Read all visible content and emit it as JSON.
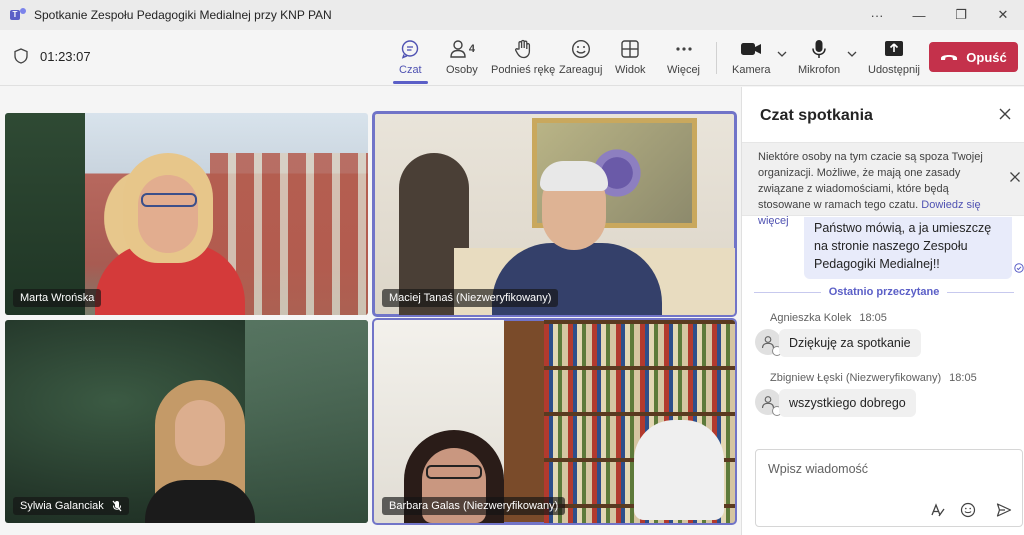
{
  "window": {
    "title": "Spotkanie Zespołu Pedagogiki Medialnej przy KNP PAN",
    "more_glyph": "···",
    "minimize_glyph": "—",
    "restore_glyph": "❐",
    "close_glyph": "✕"
  },
  "toolbar": {
    "timer": "01:23:07",
    "chat_label": "Czat",
    "people_label": "Osoby",
    "people_count": "4",
    "raise_hand_label": "Podnieś rękę",
    "react_label": "Zareaguj",
    "view_label": "Widok",
    "more_label": "Więcej",
    "camera_label": "Kamera",
    "mic_label": "Mikrofon",
    "share_label": "Udostępnij",
    "leave_label": "Opuść"
  },
  "participants": [
    {
      "name": "Marta Wrońska"
    },
    {
      "name": "Maciej Tanaś (Niezweryfikowany)"
    },
    {
      "name": "Sylwia Galanciak",
      "muted": true
    },
    {
      "name": "Barbara Galas (Niezweryfikowany)"
    }
  ],
  "chat": {
    "title": "Czat spotkania",
    "notice": "Niektóre osoby na tym czacie są spoza Twojej organizacji. Możliwe, że mają one zasady związane z wiadomościami, które będą stosowane w ramach tego czatu.",
    "notice_link": "Dowiedz się więcej",
    "my_message": "Państwo mówią, a ja umieszczę na stronie naszego Zespołu Pedagogiki Medialnej!!",
    "last_read_label": "Ostatnio przeczytane",
    "messages": [
      {
        "author": "Agnieszka Kolek",
        "time": "18:05",
        "text": "Dziękuję za spotkanie"
      },
      {
        "author": "Zbigniew Łęski (Niezweryfikowany)",
        "time": "18:05",
        "text": "wszystkiego dobrego"
      }
    ],
    "compose_placeholder": "Wpisz wiadomość"
  },
  "colors": {
    "accent": "#5b5fc7",
    "leave": "#c4314b"
  }
}
